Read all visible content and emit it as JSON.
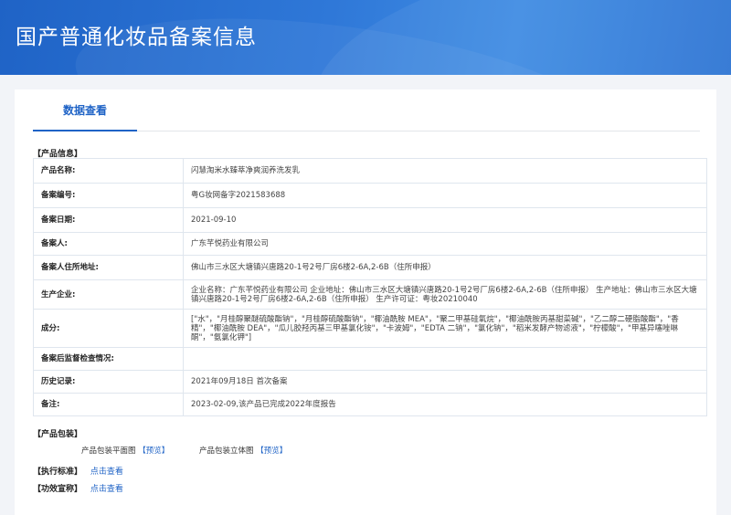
{
  "header": {
    "title": "国产普通化妆品备案信息"
  },
  "tabs": [
    {
      "label": "数据查看"
    }
  ],
  "product_info": {
    "section_title": "【产品信息】",
    "rows": [
      {
        "label": "产品名称:",
        "value": "闪慧淘米水臻萃净爽润养洗发乳"
      },
      {
        "label": "备案编号:",
        "value": "粤G妆网备字2021583688"
      },
      {
        "label": "备案日期:",
        "value": "2021-09-10"
      },
      {
        "label": "备案人:",
        "value": "广东芊悦药业有限公司"
      },
      {
        "label": "备案人住所地址:",
        "value": "佛山市三水区大塘镇兴唐路20-1号2号厂房6楼2-6A,2-6B（住所申报）"
      },
      {
        "label": "生产企业:",
        "value": "企业名称：广东芊悦药业有限公司 企业地址：佛山市三水区大塘镇兴唐路20-1号2号厂房6楼2-6A,2-6B（住所申报） 生产地址：佛山市三水区大塘镇兴唐路20-1号2号厂房6楼2-6A,2-6B（住所申报） 生产许可证：粤妆20210040"
      },
      {
        "label": "成分:",
        "value": "[\"水\"，\"月桂醇聚醚硫酸酯钠\"，\"月桂醇硫酸酯钠\"，\"椰油酰胺 MEA\"，\"聚二甲基硅氧烷\"，\"椰油酰胺丙基甜菜碱\"，\"乙二醇二硬脂酸酯\"，\"香精\"，\"椰油酰胺 DEA\"，\"瓜儿胶羟丙基三甲基氯化铵\"，\"卡波姆\"，\"EDTA 二钠\"，\"氯化钠\"，\"稻米发酵产物滤液\"，\"柠檬酸\"，\"甲基异噻唑啉酮\"，\"氨氯化钾\"]"
      },
      {
        "label": "备案后监督检查情况:",
        "value": ""
      },
      {
        "label": "历史记录:",
        "value": "2021年09月18日 首次备案"
      },
      {
        "label": "备注:",
        "value": "2023-02-09,该产品已完成2022年度报告"
      }
    ]
  },
  "packaging": {
    "section_title": "【产品包装】",
    "items": [
      {
        "label": "产品包装平面图",
        "link": "预览"
      },
      {
        "label": "产品包装立体图",
        "link": "预览"
      }
    ]
  },
  "standard": {
    "label": "【执行标准】",
    "link": "点击查看"
  },
  "efficacy": {
    "label": "【功效宣称】",
    "link": "点击查看"
  }
}
